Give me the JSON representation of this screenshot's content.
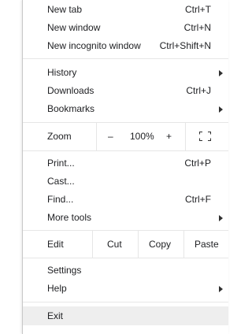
{
  "menu": {
    "new_tab": {
      "label": "New tab",
      "shortcut": "Ctrl+T"
    },
    "new_window": {
      "label": "New window",
      "shortcut": "Ctrl+N"
    },
    "new_incognito": {
      "label": "New incognito window",
      "shortcut": "Ctrl+Shift+N"
    },
    "history": {
      "label": "History"
    },
    "downloads": {
      "label": "Downloads",
      "shortcut": "Ctrl+J"
    },
    "bookmarks": {
      "label": "Bookmarks"
    },
    "zoom": {
      "label": "Zoom",
      "minus": "–",
      "value": "100%",
      "plus": "+",
      "fullscreen_icon": "fullscreen-icon"
    },
    "print": {
      "label": "Print...",
      "shortcut": "Ctrl+P"
    },
    "cast": {
      "label": "Cast..."
    },
    "find": {
      "label": "Find...",
      "shortcut": "Ctrl+F"
    },
    "more_tools": {
      "label": "More tools"
    },
    "edit": {
      "label": "Edit",
      "cut": "Cut",
      "copy": "Copy",
      "paste": "Paste"
    },
    "settings": {
      "label": "Settings"
    },
    "help": {
      "label": "Help"
    },
    "exit": {
      "label": "Exit"
    }
  },
  "colors": {
    "text": "#202124",
    "separator": "#e6e6e6",
    "hover": "#eeeeee",
    "border": "#c8c8c8"
  }
}
